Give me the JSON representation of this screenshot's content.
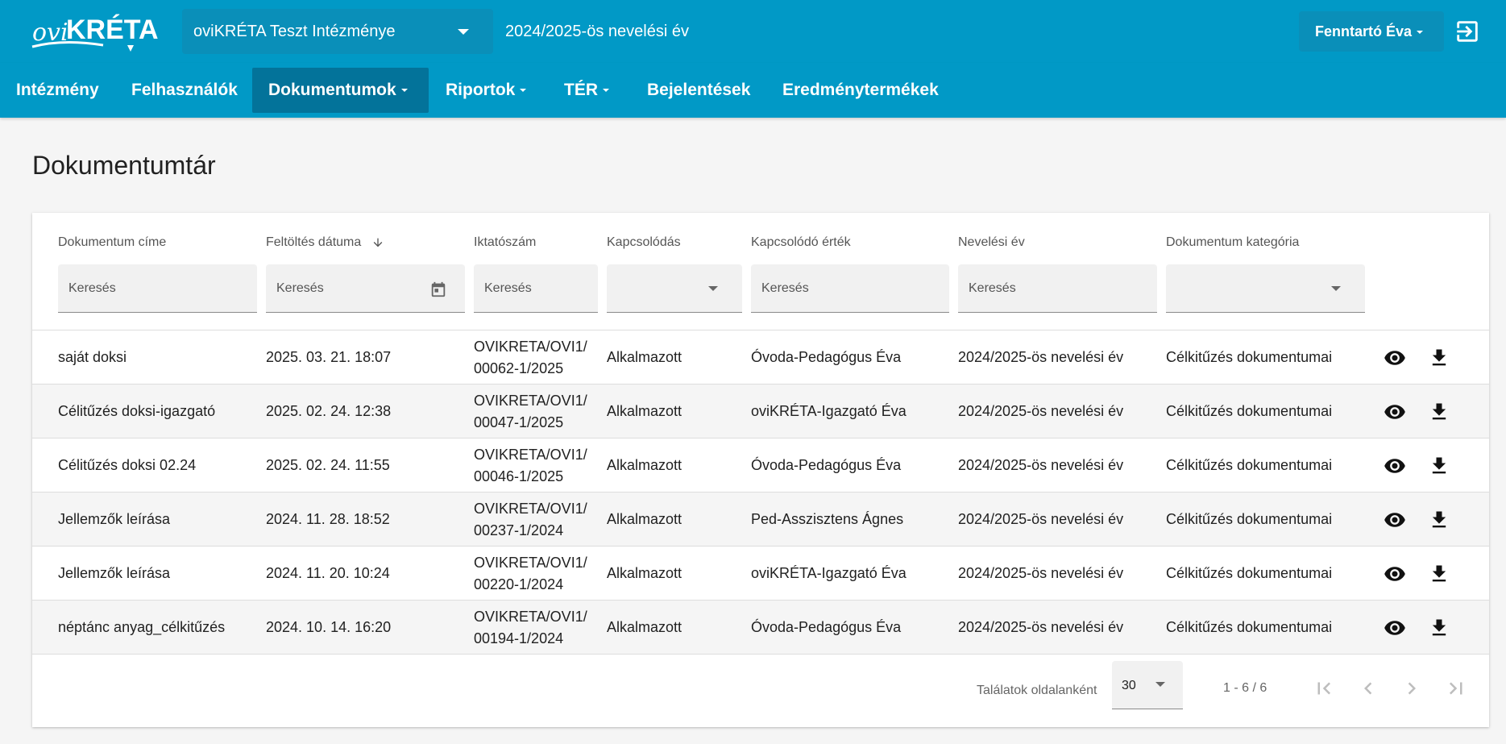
{
  "header": {
    "logo_text": "oviKRÉTA",
    "institution": "oviKRÉTA Teszt Intézménye",
    "school_year": "2024/2025-ös nevelési év",
    "user": "Fenntartó Éva",
    "colors": {
      "primary": "#0199c6",
      "active_nav": "#03739a"
    }
  },
  "nav": {
    "items": [
      {
        "label": "Intézmény"
      },
      {
        "label": "Felhasználók"
      },
      {
        "label": "Dokumentumok"
      },
      {
        "label": "Riportok"
      },
      {
        "label": "TÉR"
      },
      {
        "label": "Bejelentések"
      },
      {
        "label": "Eredménytermékek"
      }
    ]
  },
  "page": {
    "title": "Dokumentumtár"
  },
  "table": {
    "columns": [
      "Dokumentum címe",
      "Feltöltés dátuma",
      "Iktatószám",
      "Kapcsolódás",
      "Kapcsolódó érték",
      "Nevelési év",
      "Dokumentum kategória"
    ],
    "filters": {
      "title": "Keresés",
      "date": "Keresés",
      "reg": "Keresés",
      "related_value": "Keresés",
      "year": "Keresés"
    },
    "rows": [
      {
        "title": "saját doksi",
        "date": "2025. 03. 21. 18:07",
        "reg1": "OVIKRETA/OVI1/",
        "reg2": "00062-1/2025",
        "link": "Alkalmazott",
        "value": "Óvoda-Pedagógus Éva",
        "year": "2024/2025-ös nevelési év",
        "category": "Célkitűzés dokumentumai"
      },
      {
        "title": "Célitűzés doksi-igazgató",
        "date": "2025. 02. 24. 12:38",
        "reg1": "OVIKRETA/OVI1/",
        "reg2": "00047-1/2025",
        "link": "Alkalmazott",
        "value": "oviKRÉTA-Igazgató Éva",
        "year": "2024/2025-ös nevelési év",
        "category": "Célkitűzés dokumentumai"
      },
      {
        "title": "Célitűzés doksi 02.24",
        "date": "2025. 02. 24. 11:55",
        "reg1": "OVIKRETA/OVI1/",
        "reg2": "00046-1/2025",
        "link": "Alkalmazott",
        "value": "Óvoda-Pedagógus Éva",
        "year": "2024/2025-ös nevelési év",
        "category": "Célkitűzés dokumentumai"
      },
      {
        "title": "Jellemzők leírása",
        "date": "2024. 11. 28. 18:52",
        "reg1": "OVIKRETA/OVI1/",
        "reg2": "00237-1/2024",
        "link": "Alkalmazott",
        "value": "Ped-Asszisztens Ágnes",
        "year": "2024/2025-ös nevelési év",
        "category": "Célkitűzés dokumentumai"
      },
      {
        "title": "Jellemzők leírása",
        "date": "2024. 11. 20. 10:24",
        "reg1": "OVIKRETA/OVI1/",
        "reg2": "00220-1/2024",
        "link": "Alkalmazott",
        "value": "oviKRÉTA-Igazgató Éva",
        "year": "2024/2025-ös nevelési év",
        "category": "Célkitűzés dokumentumai"
      },
      {
        "title": "néptánc anyag_célkitűzés",
        "date": "2024. 10. 14. 16:20",
        "reg1": "OVIKRETA/OVI1/",
        "reg2": "00194-1/2024",
        "link": "Alkalmazott",
        "value": "Óvoda-Pedagógus Éva",
        "year": "2024/2025-ös nevelési év",
        "category": "Célkitűzés dokumentumai"
      }
    ]
  },
  "pagination": {
    "per_page_label": "Találatok oldalanként",
    "per_page": "30",
    "range": "1 - 6 / 6"
  }
}
